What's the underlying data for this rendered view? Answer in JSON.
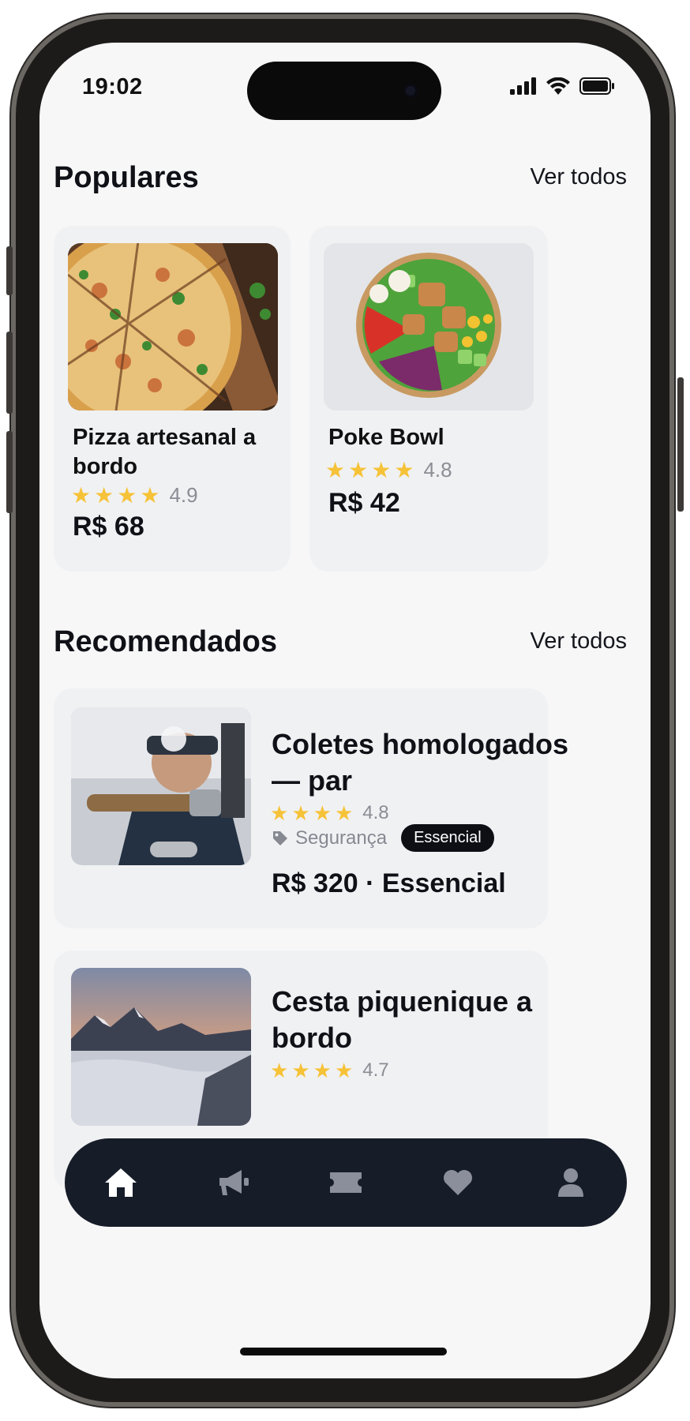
{
  "status": {
    "time": "19:02"
  },
  "popular": {
    "title": "Populares",
    "see_all": "Ver todos",
    "items": [
      {
        "name": "Pizza artesanal a bordo",
        "rating": "4.9",
        "stars": 4,
        "price": "R$ 68"
      },
      {
        "name": "Poke Bowl",
        "rating": "4.8",
        "stars": 4,
        "price": "R$ 42"
      }
    ]
  },
  "recommended": {
    "title": "Recomendados",
    "see_all": "Ver todos",
    "items": [
      {
        "name": "Coletes homologados — par",
        "rating": "4.8",
        "stars": 4,
        "category": "Segurança",
        "badge": "Essencial",
        "price": "R$ 320 · Essencial"
      },
      {
        "name": "Cesta piquenique a bordo",
        "rating": "4.7",
        "stars": 4
      }
    ]
  },
  "nav": {
    "items": [
      {
        "icon": "home-icon",
        "active": true
      },
      {
        "icon": "megaphone-icon",
        "active": false
      },
      {
        "icon": "ticket-icon",
        "active": false
      },
      {
        "icon": "heart-icon",
        "active": false
      },
      {
        "icon": "user-icon",
        "active": false
      }
    ]
  },
  "colors": {
    "star": "#f6c238",
    "tabbar": "#161c28",
    "card": "#f0f1f3",
    "badge": "#0d0f15"
  }
}
